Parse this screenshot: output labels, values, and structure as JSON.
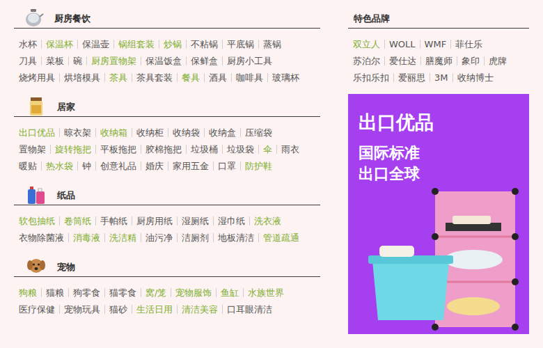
{
  "categories": [
    {
      "title": "厨房餐饮",
      "rows": [
        [
          {
            "label": "水杯",
            "highlight": false
          },
          {
            "label": "保温杯",
            "highlight": true
          },
          {
            "label": "保温壶",
            "highlight": false
          },
          {
            "label": "锅组套装",
            "highlight": true
          },
          {
            "label": "炒锅",
            "highlight": true
          },
          {
            "label": "不粘锅",
            "highlight": false
          },
          {
            "label": "平底锅",
            "highlight": false
          },
          {
            "label": "蒸锅",
            "highlight": false
          }
        ],
        [
          {
            "label": "刀具",
            "highlight": false
          },
          {
            "label": "菜板",
            "highlight": false
          },
          {
            "label": "碗",
            "highlight": false
          },
          {
            "label": "厨房置物架",
            "highlight": true
          },
          {
            "label": "保温饭盒",
            "highlight": false
          },
          {
            "label": "保鲜盒",
            "highlight": false
          },
          {
            "label": "厨房小工具",
            "highlight": false
          }
        ],
        [
          {
            "label": "烧烤用具",
            "highlight": false
          },
          {
            "label": "烘培模具",
            "highlight": false
          },
          {
            "label": "茶具",
            "highlight": true
          },
          {
            "label": "茶具套装",
            "highlight": false
          },
          {
            "label": "餐具",
            "highlight": true
          },
          {
            "label": "酒具",
            "highlight": false
          },
          {
            "label": "咖啡具",
            "highlight": false
          },
          {
            "label": "玻璃杯",
            "highlight": false
          }
        ]
      ]
    },
    {
      "title": "居家",
      "rows": [
        [
          {
            "label": "出口优品",
            "highlight": true
          },
          {
            "label": "晾衣架",
            "highlight": false
          },
          {
            "label": "收纳箱",
            "highlight": true
          },
          {
            "label": "收纳柜",
            "highlight": false
          },
          {
            "label": "收纳袋",
            "highlight": false
          },
          {
            "label": "收纳盒",
            "highlight": false
          },
          {
            "label": "压缩袋",
            "highlight": false
          }
        ],
        [
          {
            "label": "置物架",
            "highlight": false
          },
          {
            "label": "旋转拖把",
            "highlight": true
          },
          {
            "label": "平板拖把",
            "highlight": false
          },
          {
            "label": "胶棉拖把",
            "highlight": false
          },
          {
            "label": "垃圾桶",
            "highlight": false
          },
          {
            "label": "垃圾袋",
            "highlight": false
          },
          {
            "label": "伞",
            "highlight": true
          },
          {
            "label": "雨衣",
            "highlight": false
          }
        ],
        [
          {
            "label": "暖贴",
            "highlight": false
          },
          {
            "label": "热水袋",
            "highlight": true
          },
          {
            "label": "钟",
            "highlight": false
          },
          {
            "label": "创意礼品",
            "highlight": false
          },
          {
            "label": "婚庆",
            "highlight": false
          },
          {
            "label": "家用五金",
            "highlight": false
          },
          {
            "label": "口罩",
            "highlight": false
          },
          {
            "label": "防护鞋",
            "highlight": true
          }
        ]
      ]
    },
    {
      "title": "纸品",
      "rows": [
        [
          {
            "label": "软包抽纸",
            "highlight": true
          },
          {
            "label": "卷筒纸",
            "highlight": true
          },
          {
            "label": "手帕纸",
            "highlight": false
          },
          {
            "label": "厨房用纸",
            "highlight": false
          },
          {
            "label": "湿厕纸",
            "highlight": false
          },
          {
            "label": "湿巾纸",
            "highlight": false
          },
          {
            "label": "洗衣液",
            "highlight": true
          }
        ],
        [
          {
            "label": "衣物除菌液",
            "highlight": false
          },
          {
            "label": "消毒液",
            "highlight": true
          },
          {
            "label": "洗洁精",
            "highlight": true
          },
          {
            "label": "油污净",
            "highlight": false
          },
          {
            "label": "洁厕剂",
            "highlight": false
          },
          {
            "label": "地板清洁",
            "highlight": false
          },
          {
            "label": "管道疏通",
            "highlight": true
          }
        ]
      ]
    },
    {
      "title": "宠物",
      "rows": [
        [
          {
            "label": "狗粮",
            "highlight": true
          },
          {
            "label": "猫粮",
            "highlight": false
          },
          {
            "label": "狗零食",
            "highlight": false
          },
          {
            "label": "猫零食",
            "highlight": false
          },
          {
            "label": "窝/笼",
            "highlight": true
          },
          {
            "label": "宠物服饰",
            "highlight": true
          },
          {
            "label": "鱼缸",
            "highlight": true
          },
          {
            "label": "水族世界",
            "highlight": true
          }
        ],
        [
          {
            "label": "医疗保健",
            "highlight": false
          },
          {
            "label": "宠物玩具",
            "highlight": false
          },
          {
            "label": "猫砂",
            "highlight": false
          },
          {
            "label": "生活日用",
            "highlight": true
          },
          {
            "label": "清洁美容",
            "highlight": true
          },
          {
            "label": "口耳眼清洁",
            "highlight": false
          }
        ]
      ]
    }
  ],
  "brands": {
    "title": "特色品牌",
    "rows": [
      [
        {
          "label": "双立人",
          "highlight": true
        },
        {
          "label": "WOLL",
          "highlight": false
        },
        {
          "label": "WMF",
          "highlight": false
        },
        {
          "label": "菲仕乐",
          "highlight": false
        }
      ],
      [
        {
          "label": "苏泊尔",
          "highlight": false
        },
        {
          "label": "爱仕达",
          "highlight": false
        },
        {
          "label": "膳魔师",
          "highlight": false
        },
        {
          "label": "象印",
          "highlight": false
        },
        {
          "label": "虎牌",
          "highlight": false
        }
      ],
      [
        {
          "label": "乐扣乐扣",
          "highlight": false
        },
        {
          "label": "爱丽思",
          "highlight": false
        },
        {
          "label": "3M",
          "highlight": false
        },
        {
          "label": "收纳博士",
          "highlight": false
        }
      ]
    ]
  },
  "banner": {
    "title": "出口优品",
    "lines": [
      "国际标准",
      "出口全球"
    ]
  }
}
